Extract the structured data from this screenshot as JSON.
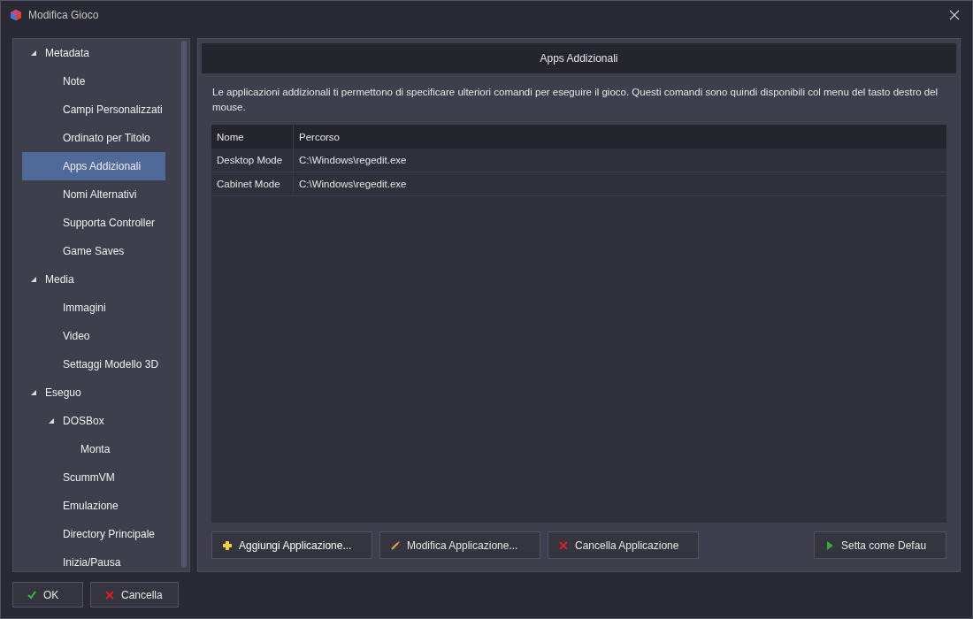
{
  "window": {
    "title": "Modifica Gioco"
  },
  "tree": [
    {
      "label": "Metadata",
      "expanded": true,
      "selected": false,
      "children": [
        {
          "label": "Note",
          "selected": false
        },
        {
          "label": "Campi Personalizzati",
          "selected": false
        },
        {
          "label": "Ordinato per Titolo",
          "selected": false
        },
        {
          "label": "Apps Addizionali",
          "selected": true
        },
        {
          "label": "Nomi Alternativi",
          "selected": false
        },
        {
          "label": "Supporta Controller",
          "selected": false
        },
        {
          "label": "Game Saves",
          "selected": false
        }
      ]
    },
    {
      "label": "Media",
      "expanded": true,
      "selected": false,
      "children": [
        {
          "label": "Immagini",
          "selected": false
        },
        {
          "label": "Video",
          "selected": false
        },
        {
          "label": "Settaggi Modello 3D",
          "selected": false
        }
      ]
    },
    {
      "label": "Eseguo",
      "expanded": true,
      "selected": false,
      "children": [
        {
          "label": "DOSBox",
          "expanded": true,
          "selected": false,
          "children": [
            {
              "label": "Monta",
              "selected": false
            }
          ]
        },
        {
          "label": "ScummVM",
          "selected": false
        },
        {
          "label": "Emulazione",
          "selected": false
        },
        {
          "label": "Directory Principale",
          "selected": false
        },
        {
          "label": "Inizia/Pausa",
          "selected": false
        }
      ]
    }
  ],
  "panel": {
    "title": "Apps Addizionali",
    "description": "Le applicazioni addizionali ti permettono di specificare ulteriori comandi per eseguire il gioco. Questi comandi sono quindi disponibili col menu del tasto destro del mouse.",
    "table": {
      "columns": [
        "Nome",
        "Percorso"
      ],
      "rows": [
        [
          "Desktop Mode",
          "C:\\Windows\\regedit.exe"
        ],
        [
          "Cabinet Mode",
          "C:\\Windows\\regedit.exe"
        ]
      ]
    },
    "buttons": [
      {
        "kind": "add",
        "label": "Aggiungi Applicazione..."
      },
      {
        "kind": "edit",
        "label": "Modifica Applicazione..."
      },
      {
        "kind": "delete",
        "label": "Cancella Applicazione"
      },
      {
        "kind": "play",
        "label": "Setta come Defau"
      }
    ]
  },
  "footer_buttons": [
    {
      "kind": "ok",
      "label": "OK"
    },
    {
      "kind": "delete",
      "label": "Cancella"
    }
  ]
}
